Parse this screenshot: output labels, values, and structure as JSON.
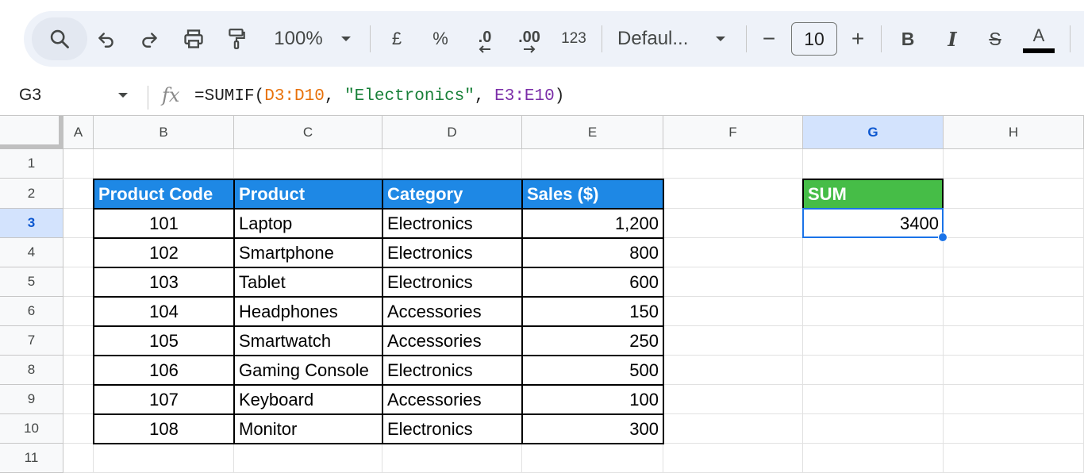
{
  "toolbar": {
    "icons": [
      "search-icon",
      "undo-icon",
      "redo-icon",
      "print-icon",
      "paint-format-icon"
    ],
    "zoom": "100%",
    "currency_symbol": "£",
    "percent_symbol": "%",
    "decrease_decimal": ".0",
    "increase_decimal": ".00",
    "number_format": "123",
    "font": "Defaul...",
    "font_size": "10",
    "minus": "−",
    "plus": "+",
    "bold": "B",
    "italic": "I",
    "strikethrough": "S",
    "text_color": "A",
    "text_color_value": "#000000"
  },
  "formula_bar": {
    "name_box": "G3",
    "fx": "fx",
    "formula_prefix": "=SUMIF(",
    "range1": "D3:D10",
    "sep1": ", ",
    "criteria": "\"Electronics\"",
    "sep2": ", ",
    "range2": "E3:E10",
    "formula_suffix": ")"
  },
  "columns": [
    "A",
    "B",
    "C",
    "D",
    "E",
    "F",
    "G",
    "H"
  ],
  "rows": [
    "1",
    "2",
    "3",
    "4",
    "5",
    "6",
    "7",
    "8",
    "9",
    "10",
    "11"
  ],
  "selected_cell": {
    "column": "G",
    "row": "3"
  },
  "table": {
    "headers": [
      "Product Code",
      "Product",
      "Category",
      "Sales ($)"
    ],
    "header_color": "#1e88e5",
    "rows": [
      [
        "101",
        "Laptop",
        "Electronics",
        "1,200"
      ],
      [
        "102",
        "Smartphone",
        "Electronics",
        "800"
      ],
      [
        "103",
        "Tablet",
        "Electronics",
        "600"
      ],
      [
        "104",
        "Headphones",
        "Accessories",
        "150"
      ],
      [
        "105",
        "Smartwatch",
        "Accessories",
        "250"
      ],
      [
        "106",
        "Gaming Console",
        "Electronics",
        "500"
      ],
      [
        "107",
        "Keyboard",
        "Accessories",
        "100"
      ],
      [
        "108",
        "Monitor",
        "Electronics",
        "300"
      ]
    ]
  },
  "sum_block": {
    "header": "SUM",
    "header_color": "#46bd47",
    "value": "3400"
  }
}
